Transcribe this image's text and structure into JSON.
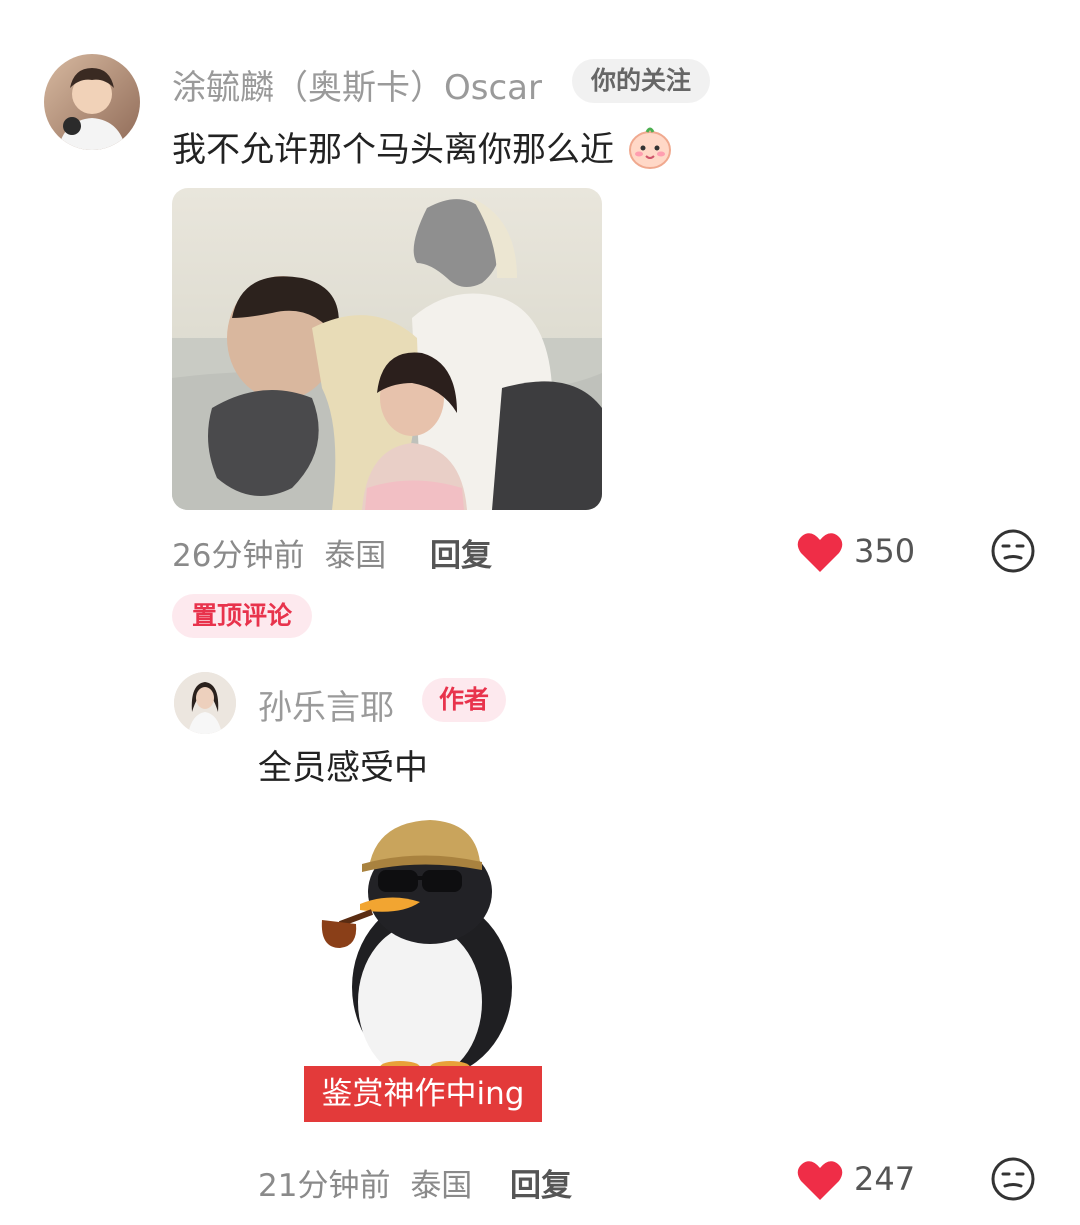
{
  "comment1": {
    "username": "涂毓麟（奥斯卡）Oscar",
    "badge": "你的关注",
    "text": "我不允许那个马头离你那么近",
    "time": "26分钟前",
    "location": "泰国",
    "reply": "回复",
    "likes": "350",
    "pinned": "置顶评论"
  },
  "comment2": {
    "username": "孙乐言耶",
    "badge": "作者",
    "text": "全员感受中",
    "sticker_caption": "鉴赏神作中ing",
    "time": "21分钟前",
    "location": "泰国",
    "reply": "回复",
    "likes": "247"
  },
  "colors": {
    "accent": "#e8334c",
    "like_heart": "#ef2d47"
  }
}
